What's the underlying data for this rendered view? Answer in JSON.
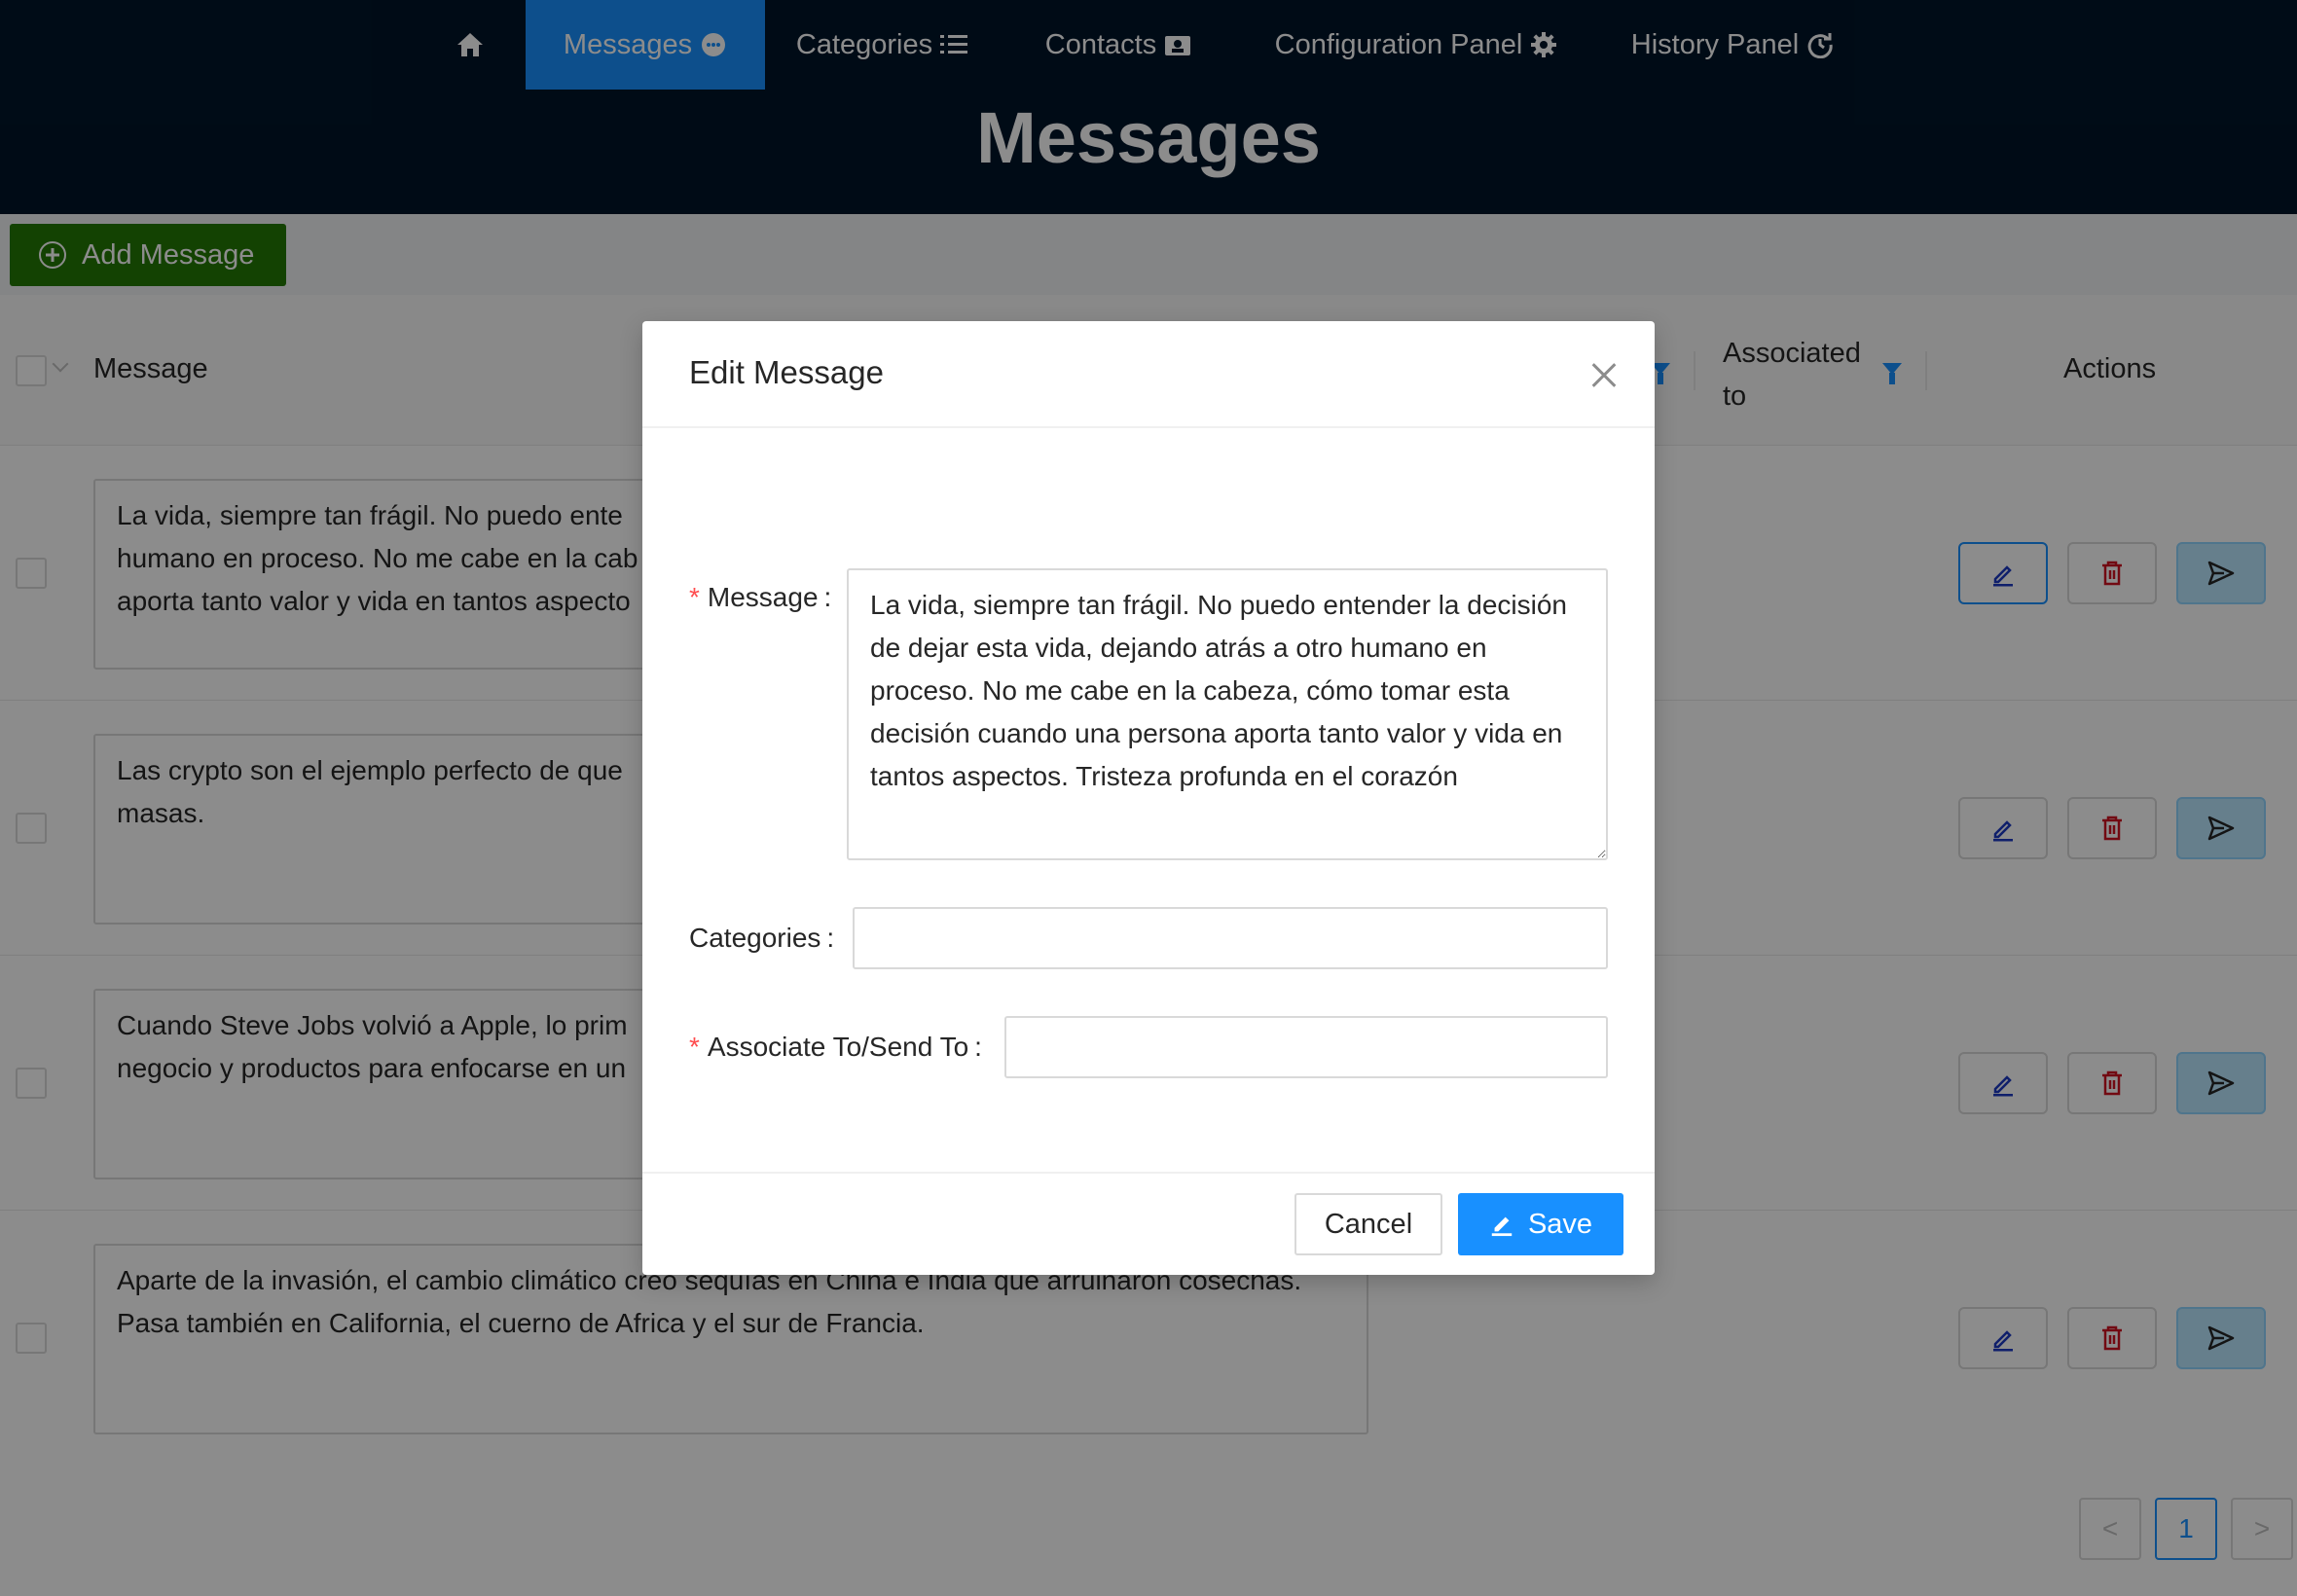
{
  "nav": {
    "home_icon": "home-icon",
    "items": [
      {
        "label": "Messages",
        "icon": "message-icon",
        "active": true
      },
      {
        "label": "Categories",
        "icon": "list-icon"
      },
      {
        "label": "Contacts",
        "icon": "contacts-icon"
      },
      {
        "label": "Configuration Panel",
        "icon": "gear-icon"
      },
      {
        "label": "History Panel",
        "icon": "history-icon"
      }
    ]
  },
  "page": {
    "title": "Messages"
  },
  "toolbar": {
    "add_label": "Add Message"
  },
  "table": {
    "columns": {
      "message": "Message",
      "associated": "Associated to",
      "actions": "Actions"
    },
    "rows": [
      {
        "message": "La vida, siempre tan frágil. No puedo ente\nhumano en proceso. No me cabe en la cab\naporta tanto valor y vida en tantos aspecto"
      },
      {
        "message": "Las crypto son el ejemplo perfecto de que\nmasas."
      },
      {
        "message": "Cuando Steve Jobs volvió a Apple, lo prim\nnegocio y productos para enfocarse en un"
      },
      {
        "message": "Aparte de la invasión, el cambio climático creó sequías en China e India que arruinaron cosechas.\nPasa también en California, el cuerno de Africa y el sur de Francia."
      }
    ]
  },
  "pagination": {
    "prev": "<",
    "current": "1",
    "next": ">"
  },
  "modal": {
    "title": "Edit Message",
    "message_label": "Message",
    "message_value": "La vida, siempre tan frágil. No puedo entender la decisión de dejar esta vida, dejando atrás a otro humano en proceso. No me cabe en la cabeza, cómo tomar esta decisión cuando una persona aporta tanto valor y vida en tantos aspectos. Tristeza profunda en el corazón",
    "categories_label": "Categories",
    "associate_label": "Associate To/Send To",
    "required_mark": "*",
    "colon": ":",
    "cancel_label": "Cancel",
    "save_label": "Save"
  },
  "colors": {
    "nav_bg": "#001529",
    "accent": "#1890ff",
    "add_button": "#237804",
    "danger": "#ff4d4f"
  }
}
